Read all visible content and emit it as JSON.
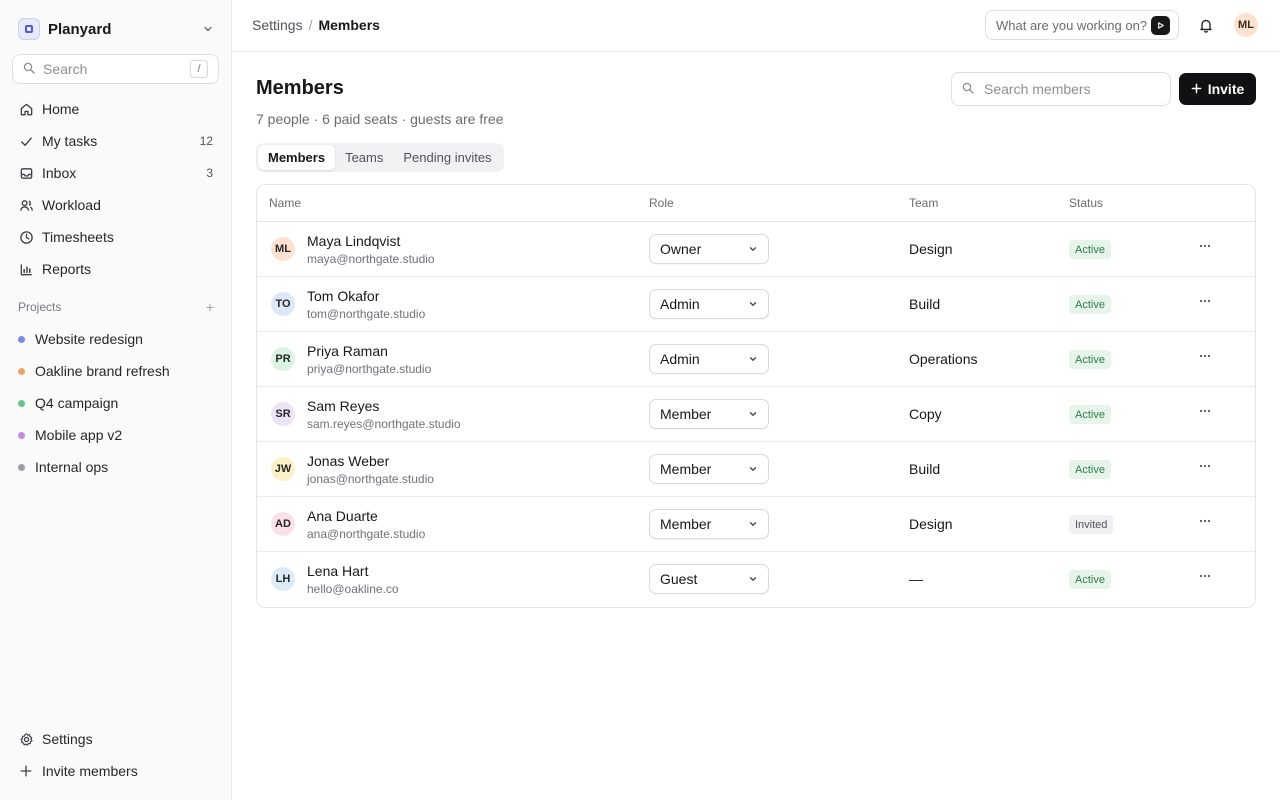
{
  "workspace": {
    "name": "Planyard"
  },
  "sidebar": {
    "search_placeholder": "Search",
    "search_shortcut": "/",
    "nav": [
      {
        "label": "Home",
        "icon": "home-icon",
        "count": ""
      },
      {
        "label": "My tasks",
        "icon": "check-icon",
        "count": "12"
      },
      {
        "label": "Inbox",
        "icon": "inbox-icon",
        "count": "3"
      },
      {
        "label": "Workload",
        "icon": "users-icon",
        "count": ""
      },
      {
        "label": "Timesheets",
        "icon": "clock-icon",
        "count": ""
      },
      {
        "label": "Reports",
        "icon": "bar-chart-icon",
        "count": ""
      }
    ],
    "projects_heading": "Projects",
    "projects": [
      {
        "label": "Website redesign",
        "color": "#7b8ce0"
      },
      {
        "label": "Oakline brand refresh",
        "color": "#eba36a"
      },
      {
        "label": "Q4 campaign",
        "color": "#6cc28b"
      },
      {
        "label": "Mobile app v2",
        "color": "#c08be0"
      },
      {
        "label": "Internal ops",
        "color": "#9e9ea6"
      }
    ],
    "bottom": [
      {
        "label": "Settings",
        "icon": "gear-icon"
      },
      {
        "label": "Invite members",
        "icon": "plus-icon"
      }
    ]
  },
  "topbar": {
    "breadcrumb": [
      "Settings",
      "Members"
    ],
    "breadcrumb_sep": "/",
    "command_placeholder": "What are you working on?",
    "user_initials": "ML"
  },
  "page": {
    "title": "Members",
    "subtitle": "7 people · 6 paid seats · guests are free",
    "search_placeholder": "Search members",
    "invite_label": "Invite",
    "tabs": [
      "Members",
      "Teams",
      "Pending invites"
    ],
    "active_tab": 0
  },
  "table": {
    "columns": [
      "Name",
      "Role",
      "Team",
      "Status"
    ],
    "rows": [
      {
        "initials": "ML",
        "name": "Maya Lindqvist",
        "email": "maya@northgate.studio",
        "role": "Owner",
        "team": "Design",
        "status": "Active",
        "avatar_bg": "#fde3cf"
      },
      {
        "initials": "TO",
        "name": "Tom Okafor",
        "email": "tom@northgate.studio",
        "role": "Admin",
        "team": "Build",
        "status": "Active",
        "avatar_bg": "#dce8f8"
      },
      {
        "initials": "PR",
        "name": "Priya Raman",
        "email": "priya@northgate.studio",
        "role": "Admin",
        "team": "Operations",
        "status": "Active",
        "avatar_bg": "#dcf2e2"
      },
      {
        "initials": "SR",
        "name": "Sam Reyes",
        "email": "sam.reyes@northgate.studio",
        "role": "Member",
        "team": "Copy",
        "status": "Active",
        "avatar_bg": "#ece3f7"
      },
      {
        "initials": "JW",
        "name": "Jonas Weber",
        "email": "jonas@northgate.studio",
        "role": "Member",
        "team": "Build",
        "status": "Active",
        "avatar_bg": "#fbf0c6"
      },
      {
        "initials": "AD",
        "name": "Ana Duarte",
        "email": "ana@northgate.studio",
        "role": "Member",
        "team": "Design",
        "status": "Invited",
        "avatar_bg": "#fbe2ea"
      },
      {
        "initials": "LH",
        "name": "Lena Hart",
        "email": "hello@oakline.co",
        "role": "Guest",
        "team": "—",
        "status": "Active",
        "avatar_bg": "#dcecf7"
      }
    ]
  },
  "colors": {
    "accent": "#111113",
    "active_bg": "#e6f4ea",
    "active_fg": "#2f7d48"
  }
}
